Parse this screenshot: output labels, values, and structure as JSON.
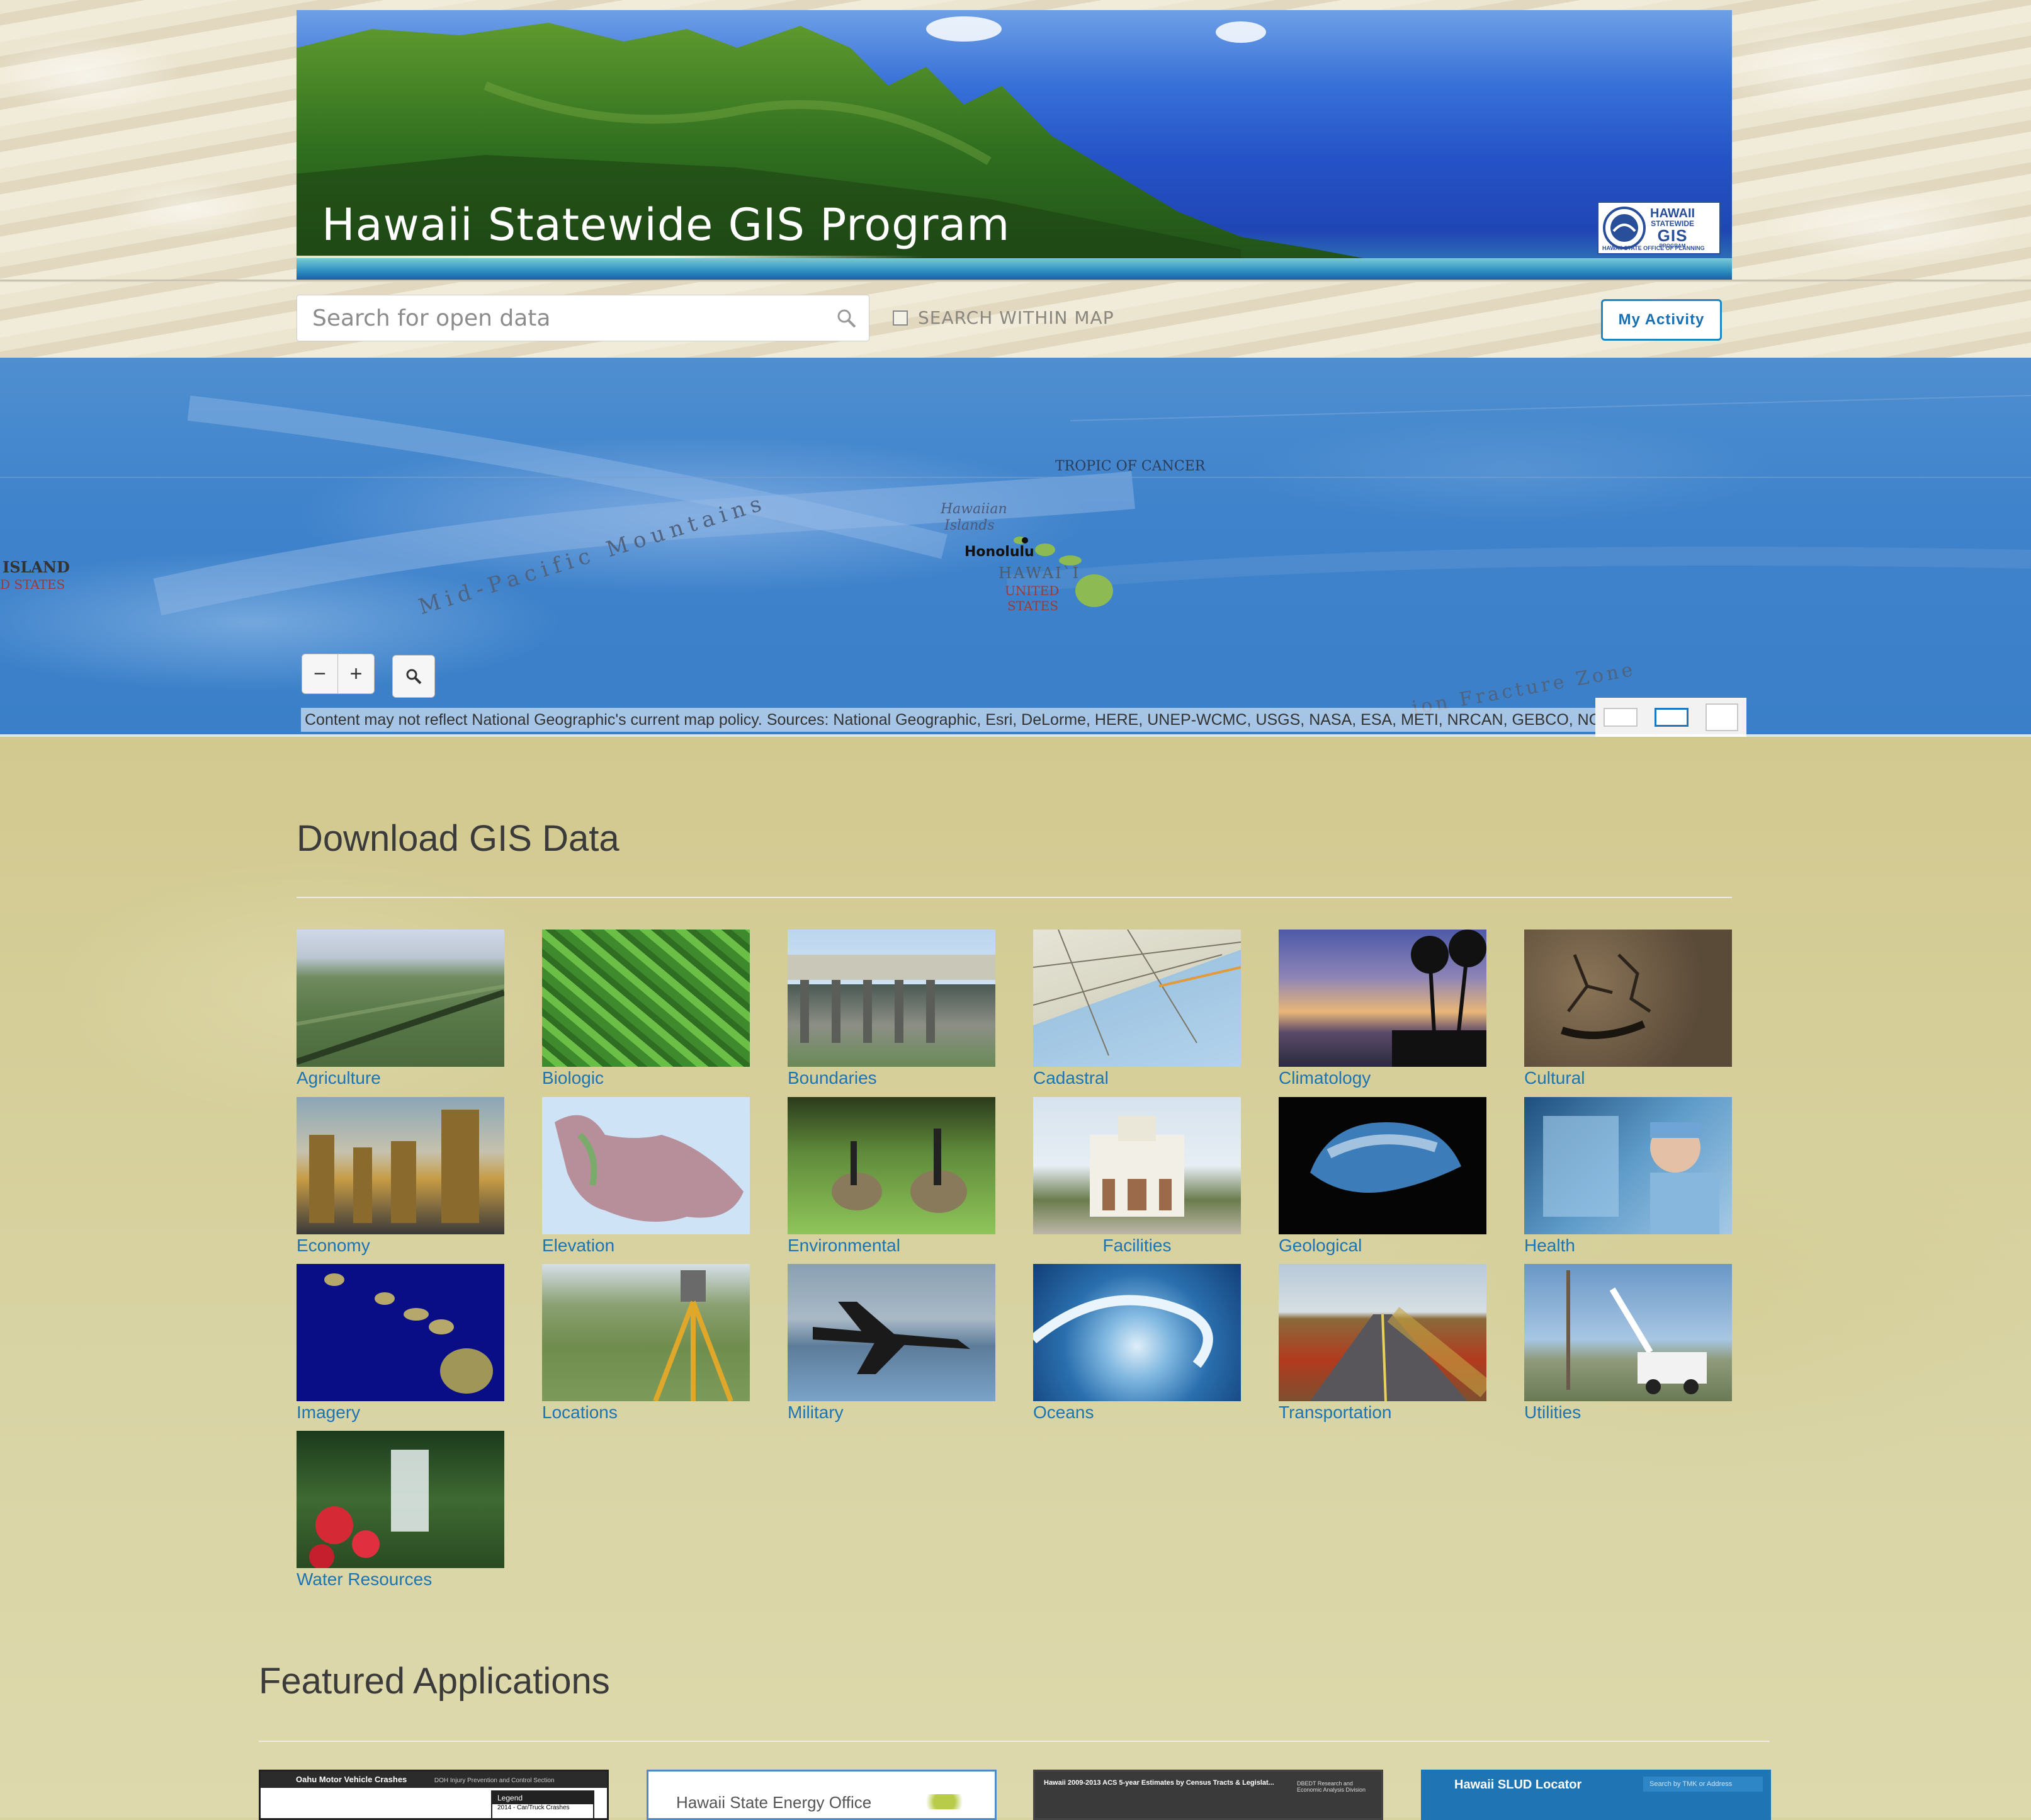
{
  "banner": {
    "title": "Hawaii Statewide GIS Program",
    "logo": {
      "line1": "HAWAII",
      "line2": "STATEWIDE",
      "line3": "GIS",
      "line4": "PROGRAM",
      "footer": "HAWAII STATE OFFICE OF PLANNING"
    }
  },
  "search": {
    "placeholder": "Search for open data",
    "within_map_label": "SEARCH WITHIN MAP"
  },
  "my_activity_label": "My Activity",
  "map": {
    "labels": {
      "tropic": "TROPIC OF CANCER",
      "hawaiian_islands_1": "Hawaiian",
      "hawaiian_islands_2": "Islands",
      "honolulu": "Honolulu",
      "hawaii": "HAWAI`I",
      "united": "UNITED",
      "states": "STATES",
      "mid_pacific": "Mid-Pacific Mountains",
      "island": "ISLAND",
      "d_states": "D STATES",
      "fracture": "ion Fracture Zone"
    },
    "zoom_out": "−",
    "zoom_in": "+",
    "attribution": "Content may not reflect National Geographic's current map policy. Sources: National Geographic, Esri, DeLorme, HERE, UNEP-WCMC, USGS, NASA, ESA, METI, NRCAN, GEBCO, NOAA, increment P Corp."
  },
  "download": {
    "title": "Download GIS Data",
    "categories": [
      {
        "label": "Agriculture"
      },
      {
        "label": "Biologic"
      },
      {
        "label": "Boundaries"
      },
      {
        "label": "Cadastral"
      },
      {
        "label": "Climatology"
      },
      {
        "label": "Cultural"
      },
      {
        "label": "Economy"
      },
      {
        "label": "Elevation"
      },
      {
        "label": "Environmental"
      },
      {
        "label": "Facilities"
      },
      {
        "label": "Geological"
      },
      {
        "label": "Health"
      },
      {
        "label": "Imagery"
      },
      {
        "label": "Locations"
      },
      {
        "label": "Military"
      },
      {
        "label": "Oceans"
      },
      {
        "label": "Transportation"
      },
      {
        "label": "Utilities"
      },
      {
        "label": "Water Resources"
      }
    ]
  },
  "featured": {
    "title": "Featured Applications",
    "apps": [
      {
        "title": "Oahu Motor Vehicle Crashes",
        "subtitle": "DOH Injury Prevention and Control Section",
        "legend": "Legend",
        "legend_item": "2014 - Car/Truck Crashes"
      },
      {
        "title": "Hawaii State Energy Office"
      },
      {
        "title": "Hawaii 2009-2013 ACS 5-year Estimates by Census Tracts & Legislat...",
        "subtitle": "DBEDT Research and Economic Analysis Division"
      },
      {
        "title": "Hawaii SLUD Locator",
        "search": "Search by TMK or Address"
      }
    ]
  }
}
